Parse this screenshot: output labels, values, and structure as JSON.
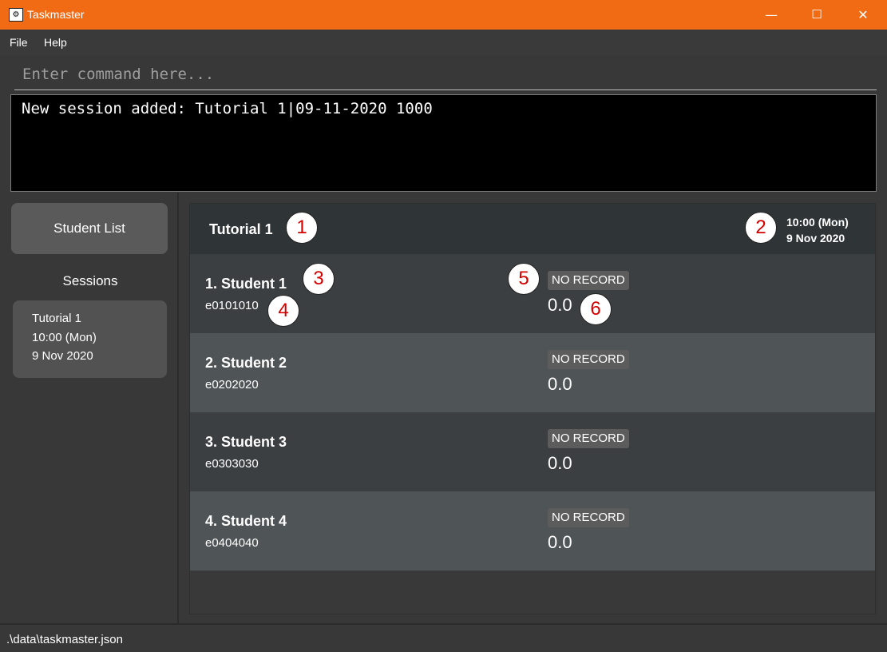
{
  "window": {
    "title": "Taskmaster",
    "icon": "app-icon",
    "minimize_icon": "—",
    "maximize_icon": "☐",
    "close_icon": "✕"
  },
  "menu": {
    "file": "File",
    "help": "Help"
  },
  "command": {
    "placeholder": "Enter command here...",
    "result": "New session added: Tutorial 1|09-11-2020 1000"
  },
  "sidebar": {
    "student_list_button": "Student List",
    "sessions_label": "Sessions",
    "sessions": [
      {
        "name": "Tutorial 1",
        "time": "10:00 (Mon)",
        "date": "9 Nov 2020"
      }
    ]
  },
  "session": {
    "title": "Tutorial 1",
    "time": "10:00 (Mon)",
    "date": "9 Nov 2020"
  },
  "students": [
    {
      "name": "1.  Student 1",
      "id": "e0101010",
      "record": "NO RECORD",
      "score": "0.0"
    },
    {
      "name": "2.  Student 2",
      "id": "e0202020",
      "record": "NO RECORD",
      "score": "0.0"
    },
    {
      "name": "3.  Student 3",
      "id": "e0303030",
      "record": "NO RECORD",
      "score": "0.0"
    },
    {
      "name": "4.  Student 4",
      "id": "e0404040",
      "record": "NO RECORD",
      "score": "0.0"
    }
  ],
  "callouts": [
    "1",
    "2",
    "3",
    "4",
    "5",
    "6"
  ],
  "status": {
    "file_path": ".\\data\\taskmaster.json"
  },
  "colors": {
    "titlebar": "#f06b13",
    "background": "#383838"
  }
}
